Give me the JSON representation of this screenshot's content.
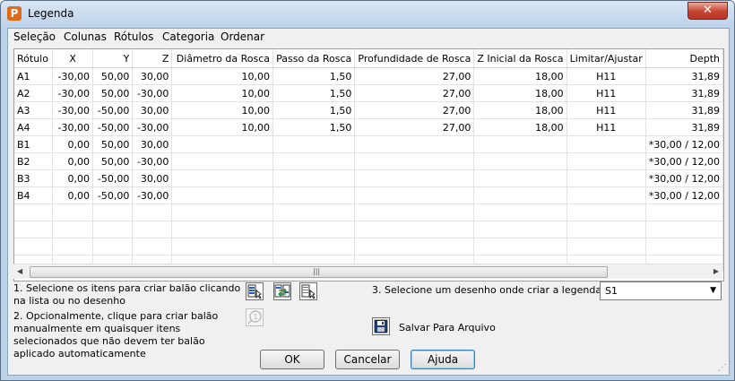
{
  "window": {
    "title": "Legenda",
    "app_icon_letter": "P",
    "close_glyph": "✕"
  },
  "menu": [
    "Seleção",
    "Colunas",
    "Rótulos",
    "Categoria",
    "Ordenar"
  ],
  "table": {
    "columns": [
      "Rótulo",
      "X",
      "Y",
      "Z",
      "Diâmetro da Rosca",
      "Passo da Rosca",
      "Profundidade de Rosca",
      "Z Inicial da Rosca",
      "Limitar/Ajustar",
      "Depth"
    ],
    "rows": [
      [
        "A1",
        "-30,00",
        "50,00",
        "30,00",
        "10,00",
        "1,50",
        "27,00",
        "18,00",
        "H11",
        "31,89"
      ],
      [
        "A2",
        "-30,00",
        "50,00",
        "-30,00",
        "10,00",
        "1,50",
        "27,00",
        "18,00",
        "H11",
        "31,89"
      ],
      [
        "A3",
        "-30,00",
        "-50,00",
        "30,00",
        "10,00",
        "1,50",
        "27,00",
        "18,00",
        "H11",
        "31,89"
      ],
      [
        "A4",
        "-30,00",
        "-50,00",
        "-30,00",
        "10,00",
        "1,50",
        "27,00",
        "18,00",
        "H11",
        "31,89"
      ],
      [
        "B1",
        "0,00",
        "50,00",
        "30,00",
        "",
        "",
        "",
        "",
        "",
        "*30,00 / 12,00"
      ],
      [
        "B2",
        "0,00",
        "50,00",
        "-30,00",
        "",
        "",
        "",
        "",
        "",
        "*30,00 / 12,00"
      ],
      [
        "B3",
        "0,00",
        "-50,00",
        "30,00",
        "",
        "",
        "",
        "",
        "",
        "*30,00 / 12,00"
      ],
      [
        "B4",
        "0,00",
        "-50,00",
        "-30,00",
        "",
        "",
        "",
        "",
        "",
        "*30,00 / 12,00"
      ]
    ],
    "empty_rows": 4
  },
  "scrollbar": {
    "left_arrow": "◀",
    "right_arrow": "▶",
    "grip": "|||"
  },
  "instructions": {
    "step1": "1. Selecione os itens para criar balão clicando na lista ou no desenho",
    "step2": "2. Opcionalmente, clique para criar balão manualmente em quaisquer itens selecionados que não devem ter balão aplicado automaticamente",
    "step3": "3. Selecione um desenho onde criar a legenda"
  },
  "drawing_select": {
    "value": "S1",
    "arrow": "▼"
  },
  "save_label": "Salvar Para Arquivo",
  "buttons": {
    "ok": "OK",
    "cancel": "Cancelar",
    "help": "Ajuda"
  },
  "icons": [
    "select-list-icon",
    "select-toggle-icon",
    "select-cursor-icon",
    "manual-balloon-icon",
    "save-floppy-icon"
  ]
}
